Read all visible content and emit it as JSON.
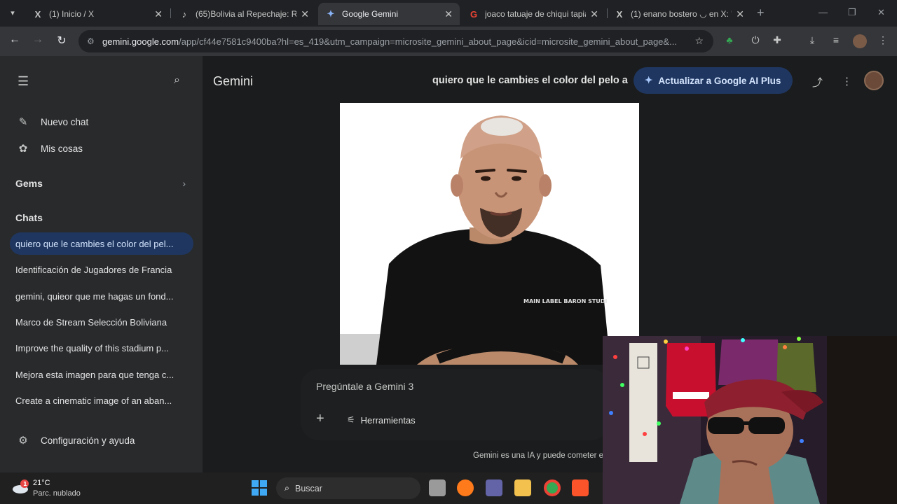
{
  "browser": {
    "tabs": [
      {
        "title": "(1) Inicio / X",
        "icon": "X"
      },
      {
        "title": "(65)Bolivia al Repechaje: Re",
        "icon": "♪"
      },
      {
        "title": "Google Gemini",
        "icon": "✦"
      },
      {
        "title": "joaco tatuaje de chiqui tapia",
        "icon": "G"
      },
      {
        "title": "(1) enano bostero ◡ en X: \"",
        "icon": "X"
      }
    ],
    "url_host": "gemini.google.com",
    "url_path": "/app/cf44e7581c9400ba?hl=es_419&utm_campaign=microsite_gemini_about_page&icid=microsite_gemini_about_page&..."
  },
  "sidebar": {
    "new_chat": "Nuevo chat",
    "my_stuff": "Mis cosas",
    "gems": "Gems",
    "chats_heading": "Chats",
    "chats": [
      "quiero que le cambies el color del pel...",
      "Identificación de Jugadores de Francia",
      "gemini, quieor que me hagas un fond...",
      "Marco de Stream Selección Boliviana",
      "Improve the quality of this stadium p...",
      "Mejora esta imagen para que tenga c...",
      "Create a cinematic image of an aban..."
    ],
    "settings": "Configuración y ayuda"
  },
  "main": {
    "brand": "Gemini",
    "conversation_title": "quiero que le cambies el color del pelo a",
    "upgrade_label": "Actualizar a Google AI Plus",
    "image_text": "MAIN LABEL BARON STUDI",
    "composer_placeholder": "Pregúntale a Gemini 3",
    "tools_label": "Herramientas",
    "disclaimer": "Gemini es una IA y puede cometer e"
  },
  "taskbar": {
    "temperature": "21°C",
    "weather_desc": "Parc. nublado",
    "search_label": "Buscar"
  },
  "colors": {
    "accent": "#1f3760",
    "accent_text": "#d3e3fd",
    "sidebar_bg": "#282a2c",
    "main_bg": "#1b1c1d"
  }
}
